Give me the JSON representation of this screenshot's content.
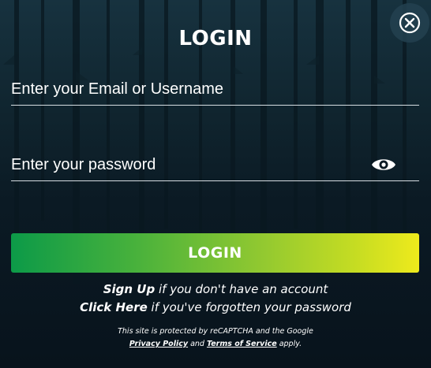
{
  "modal": {
    "title": "LOGIN",
    "close_icon": "close-icon"
  },
  "form": {
    "email_placeholder": "Enter your Email or Username",
    "email_value": "",
    "password_placeholder": "Enter your password",
    "password_value": "",
    "password_toggle_icon": "eye-icon",
    "submit_label": "LOGIN"
  },
  "links": {
    "signup_label": "Sign Up",
    "signup_text": " if you don't have an account",
    "forgot_label": "Click Here",
    "forgot_text": " if you've forgotten your password"
  },
  "recaptcha": {
    "line1": "This site is protected by reCAPTCHA and the Google",
    "privacy_label": "Privacy Policy",
    "and_text": " and ",
    "terms_label": "Terms of Service",
    "applies_text": " apply."
  },
  "colors": {
    "background": "#0b1a24",
    "button_gradient_start": "#0c9a48",
    "button_gradient_end": "#eeea1c",
    "text": "#ffffff"
  }
}
